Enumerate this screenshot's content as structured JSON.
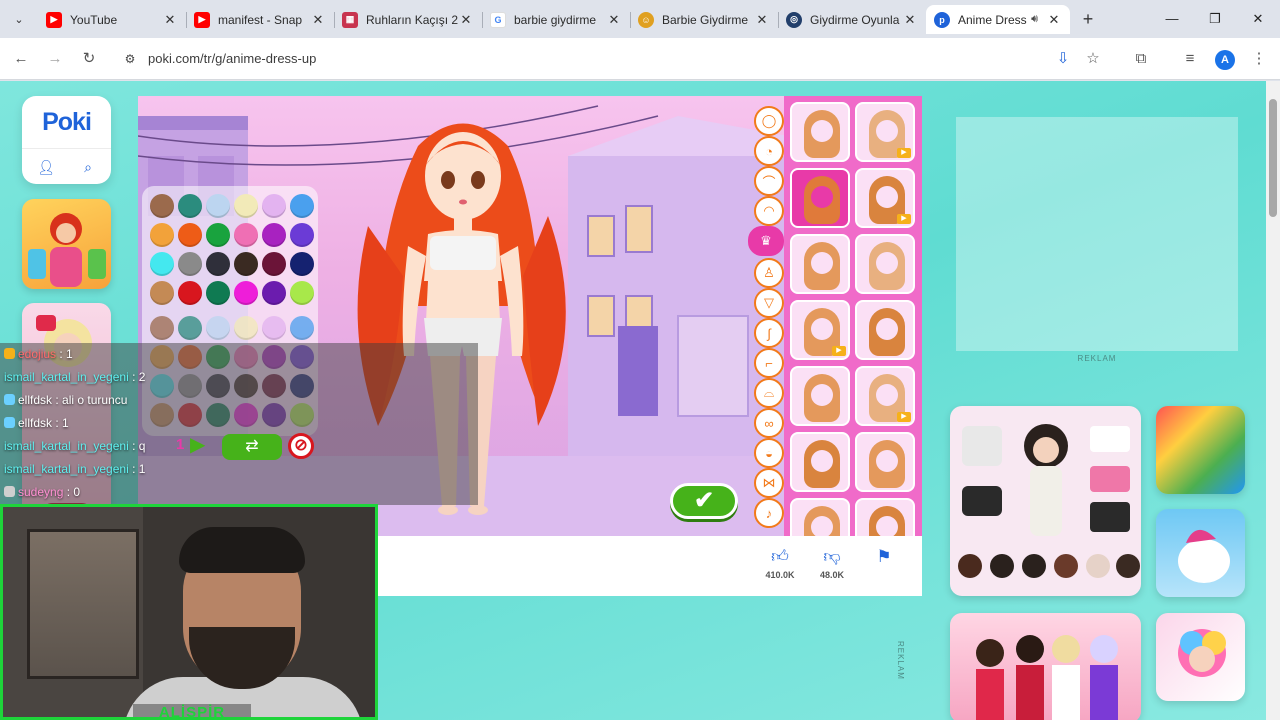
{
  "browser": {
    "tabs": [
      {
        "title": "YouTube",
        "favicon": "youtube-icon",
        "color": "#ff0000"
      },
      {
        "title": "manifest - Snap",
        "favicon": "youtube-icon",
        "color": "#ff0000"
      },
      {
        "title": "Ruhların Kaçışı 2",
        "favicon": "film-icon",
        "color": "#c8344f"
      },
      {
        "title": "barbie giydirme",
        "favicon": "google-icon",
        "color": "#4285f4"
      },
      {
        "title": "Barbie Giydirme",
        "favicon": "face-icon",
        "color": "#e0a020"
      },
      {
        "title": "Giydirme Oyunla",
        "favicon": "globe-icon",
        "color": "#223f6b"
      },
      {
        "title": "Anime Dress",
        "favicon": "poki-icon",
        "color": "#1f63d9"
      }
    ],
    "url": "poki.com/tr/g/anime-dress-up",
    "profile_initial": "A"
  },
  "site": {
    "logo": "Poki",
    "ad_label": "REKLAM",
    "ad_label_vertical": "REKLAM"
  },
  "game": {
    "likes": "410.0K",
    "dislikes": "48.0K"
  },
  "palette_colors": [
    "#9b6a4c",
    "#2b8c7e",
    "#bcd5f0",
    "#f2eab8",
    "#e3b3f0",
    "#4aa0ee",
    "#f2a23a",
    "#ee5c17",
    "#19a33e",
    "#ef6fb4",
    "#a822c0",
    "#6b3bd6",
    "#44e8ef",
    "#8a8a8a",
    "#2f2f3a",
    "#3a2a22",
    "#6b1438",
    "#152270",
    "#c48a55",
    "#d8161e",
    "#0f7a52",
    "#ee1ed9",
    "#6b1cae",
    "#a8e84a"
  ],
  "chat": [
    {
      "user": "edojius",
      "msg": "1",
      "color": "#ff6b6b"
    },
    {
      "user": "ismail_kartal_in_yegeni",
      "msg": "2",
      "color": "#5ef0f0"
    },
    {
      "user": "ellfdsk",
      "msg": "ali o turuncu",
      "color": "#ffffff"
    },
    {
      "user": "ellfdsk",
      "msg": "1",
      "color": "#ffffff"
    },
    {
      "user": "ismail_kartal_in_yegeni",
      "msg": "q",
      "color": "#5ef0f0"
    },
    {
      "user": "ismail_kartal_in_yegeni",
      "msg": "1",
      "color": "#5ef0f0"
    },
    {
      "user": "sudeyng",
      "msg": "0",
      "color": "#ff8fd2"
    }
  ],
  "chat_tools_count": "1",
  "webcam": {
    "name": "ALİSPİR"
  },
  "colors": {
    "accent": "#1f63d9",
    "page_bg": "#5fdcd2",
    "game_pink": "#f06bc9",
    "confirm_green": "#46b21a",
    "webcam_border": "#1ed43a"
  }
}
